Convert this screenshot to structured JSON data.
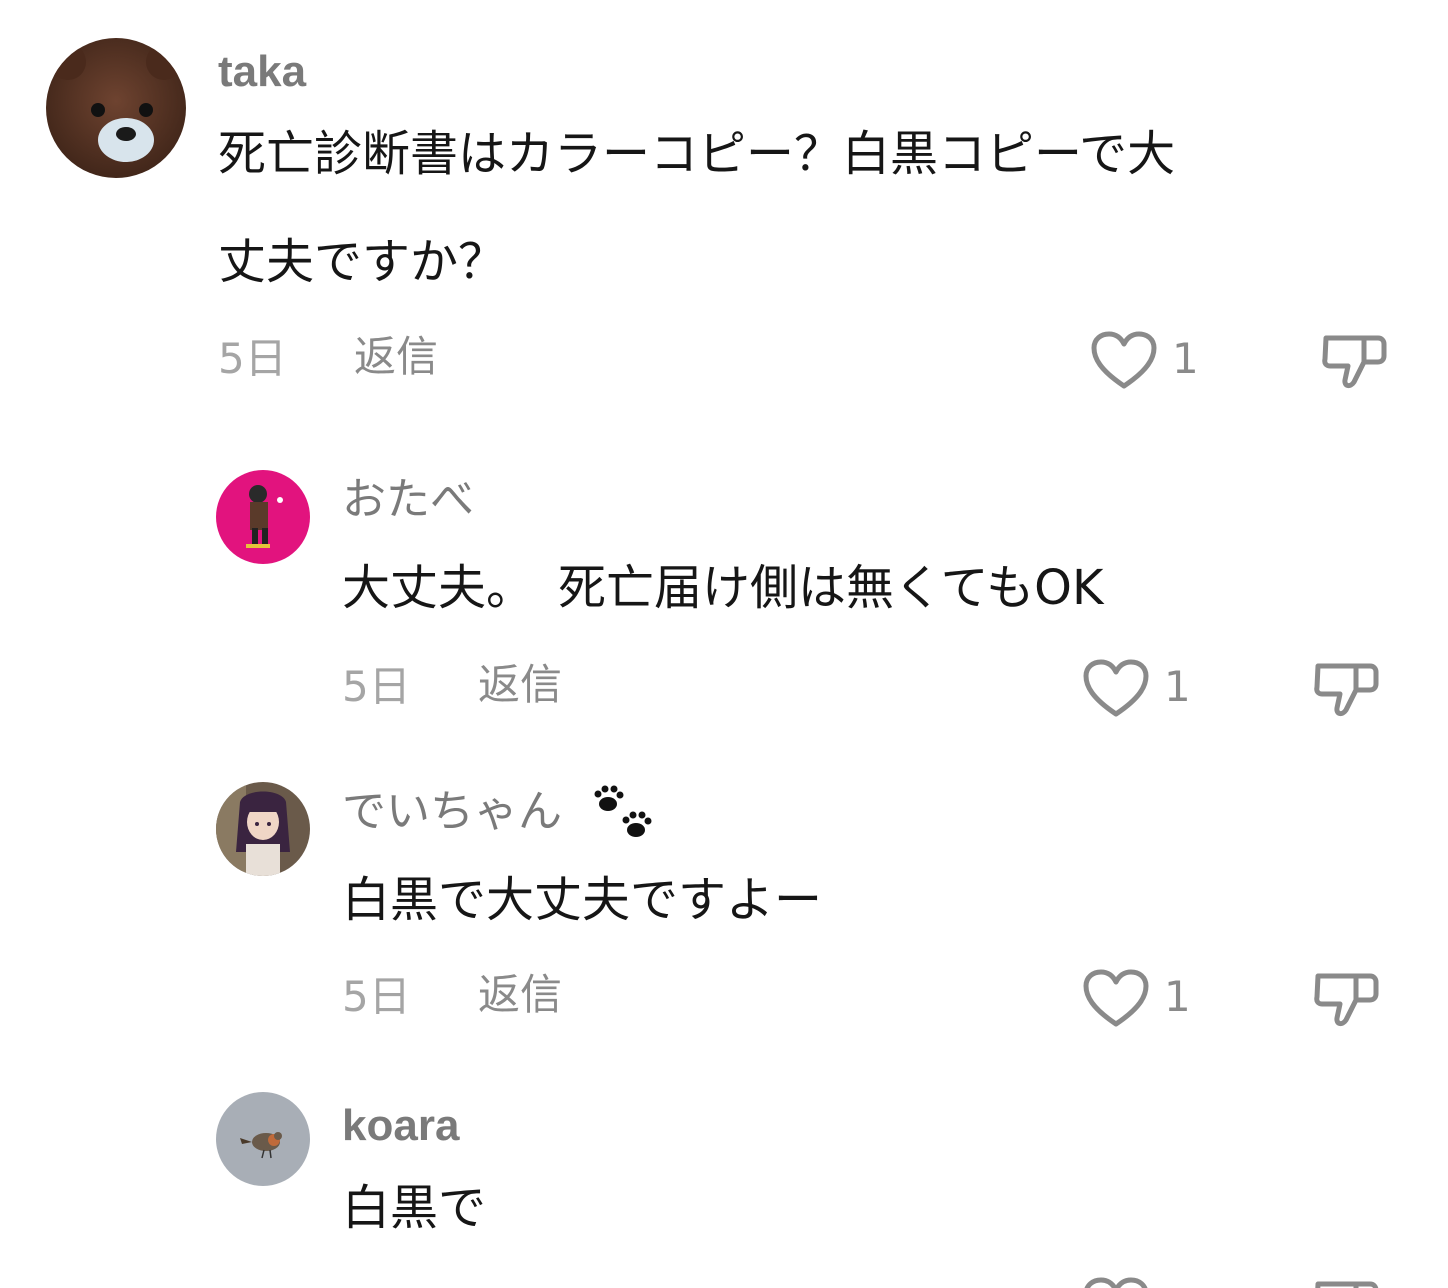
{
  "comments": [
    {
      "username": "taka",
      "text_lines": [
        "死亡診断書はカラーコピー？白黒コピーで大",
        "丈夫ですか？"
      ],
      "time": "5日",
      "reply_label": "返信",
      "like_count": "1",
      "avatar_icon": "bear-avatar"
    }
  ],
  "replies": [
    {
      "username": "おたべ",
      "text": "大丈夫。　死亡届け側は無くてもOK",
      "time": "5日",
      "reply_label": "返信",
      "like_count": "1",
      "avatar_icon": "pink-character-avatar"
    },
    {
      "username": "でいちゃん",
      "username_emoji": "paw-prints-icon",
      "text": "白黒で大丈夫ですよー",
      "time": "5日",
      "reply_label": "返信",
      "like_count": "1",
      "avatar_icon": "anime-girl-avatar"
    },
    {
      "username": "koara",
      "text": "白黒で",
      "avatar_icon": "bird-avatar"
    }
  ],
  "colors": {
    "username": "#7a7a7a",
    "text": "#161616",
    "meta": "#a5a5a5",
    "icon": "#8a8a8a"
  }
}
